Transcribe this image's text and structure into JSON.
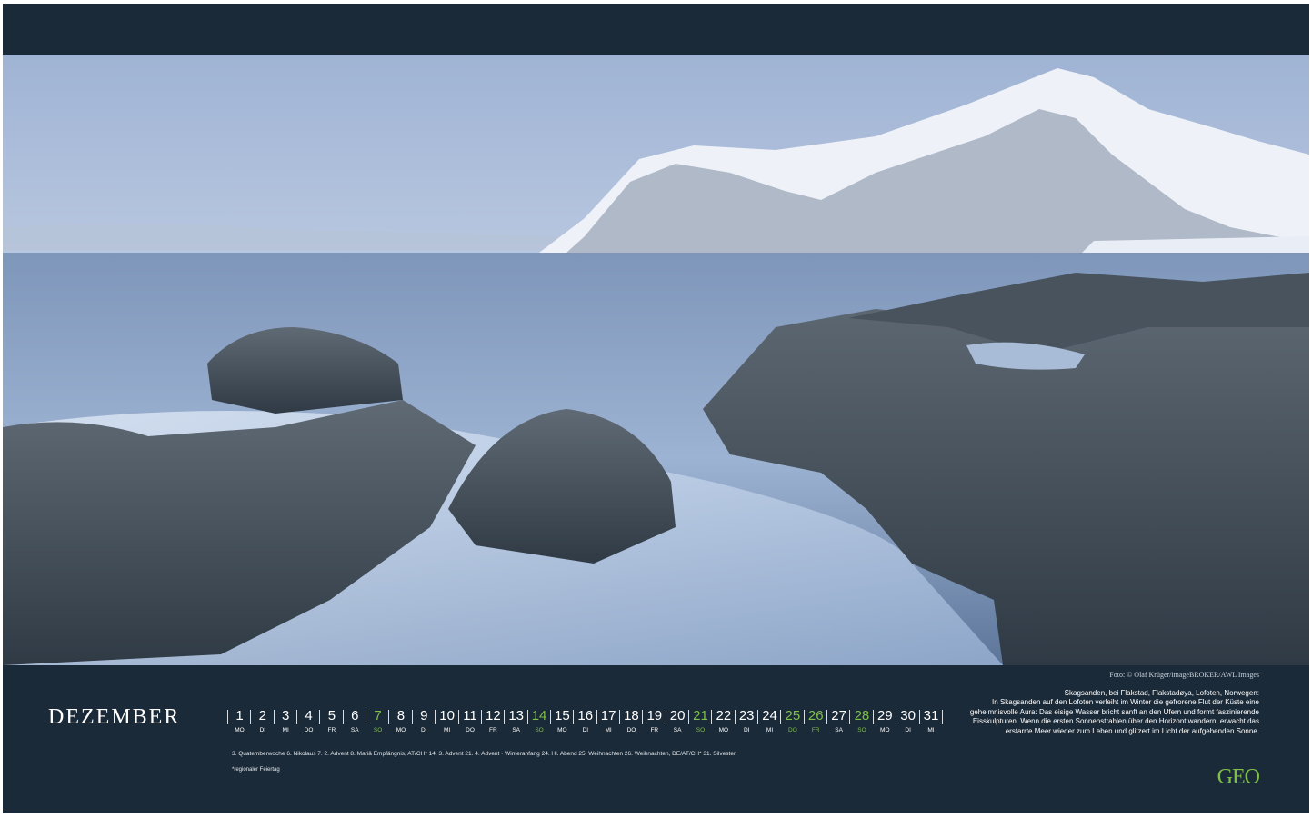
{
  "photo": {
    "credit": "Foto: © Olaf Krüger/imageBROKER/AWL Images",
    "colors": {
      "sky": "#c7d3e6",
      "sea": "#8fa9c8",
      "rock": "#4f5a64",
      "snow": "#eef2f8"
    }
  },
  "calendar": {
    "month": "DEZEMBER",
    "days": [
      {
        "n": "1",
        "wd": "MO",
        "green": false
      },
      {
        "n": "2",
        "wd": "DI",
        "green": false
      },
      {
        "n": "3",
        "wd": "MI",
        "green": false
      },
      {
        "n": "4",
        "wd": "DO",
        "green": false
      },
      {
        "n": "5",
        "wd": "FR",
        "green": false
      },
      {
        "n": "6",
        "wd": "SA",
        "green": false
      },
      {
        "n": "7",
        "wd": "SO",
        "green": true
      },
      {
        "n": "8",
        "wd": "MO",
        "green": false
      },
      {
        "n": "9",
        "wd": "DI",
        "green": false
      },
      {
        "n": "10",
        "wd": "MI",
        "green": false
      },
      {
        "n": "11",
        "wd": "DO",
        "green": false
      },
      {
        "n": "12",
        "wd": "FR",
        "green": false
      },
      {
        "n": "13",
        "wd": "SA",
        "green": false
      },
      {
        "n": "14",
        "wd": "SO",
        "green": true
      },
      {
        "n": "15",
        "wd": "MO",
        "green": false
      },
      {
        "n": "16",
        "wd": "DI",
        "green": false
      },
      {
        "n": "17",
        "wd": "MI",
        "green": false
      },
      {
        "n": "18",
        "wd": "DO",
        "green": false
      },
      {
        "n": "19",
        "wd": "FR",
        "green": false
      },
      {
        "n": "20",
        "wd": "SA",
        "green": false
      },
      {
        "n": "21",
        "wd": "SO",
        "green": true
      },
      {
        "n": "22",
        "wd": "MO",
        "green": false
      },
      {
        "n": "23",
        "wd": "DI",
        "green": false
      },
      {
        "n": "24",
        "wd": "MI",
        "green": false
      },
      {
        "n": "25",
        "wd": "DO",
        "green": true
      },
      {
        "n": "26",
        "wd": "FR",
        "green": true
      },
      {
        "n": "27",
        "wd": "SA",
        "green": false
      },
      {
        "n": "28",
        "wd": "SO",
        "green": true
      },
      {
        "n": "29",
        "wd": "MO",
        "green": false
      },
      {
        "n": "30",
        "wd": "DI",
        "green": false
      },
      {
        "n": "31",
        "wd": "MI",
        "green": false
      }
    ],
    "holidays": "3. Quatemberwoche   6. Nikolaus   7. 2. Advent   8. Mariä Empfängnis, AT/CH*   14. 3. Advent   21. 4. Advent · Winteranfang   24. Hl. Abend   25. Weihnachten   26. Weihnachten, DE/AT/CH*   31. Silvester",
    "footnote": "*regionaler Feiertag"
  },
  "caption": {
    "title": "Skagsanden, bei Flakstad, Flakstadøya, Lofoten, Norwegen:",
    "body": "In Skagsanden auf den Lofoten verleiht im Winter die gefrorene Flut der Küste eine geheimnisvolle Aura: Das eisige Wasser bricht sanft an den Ufern und formt faszinierende Eisskulpturen. Wenn die ersten Sonnenstrahlen über den Horizont wandern, erwacht das erstarrte Meer wieder zum Leben und glitzert im Licht der aufgehenden Sonne."
  },
  "brand": {
    "logo": "GEO",
    "accent": "#7fbf4a"
  }
}
